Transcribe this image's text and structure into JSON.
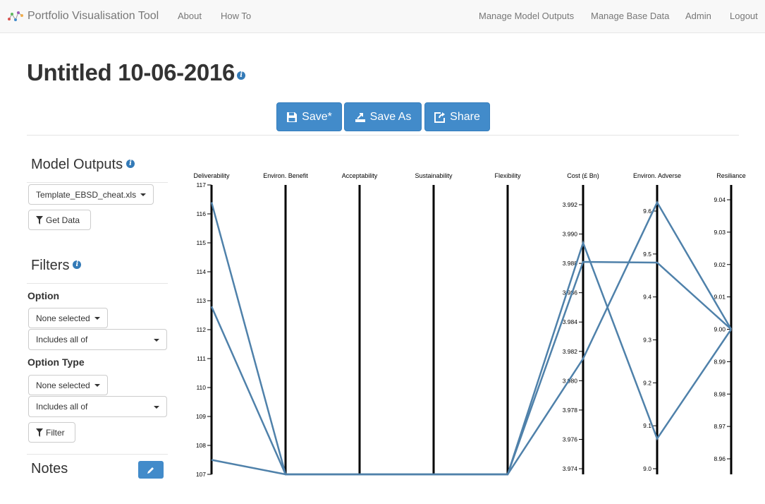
{
  "navbar": {
    "brand": "Portfolio Visualisation Tool",
    "links_left": [
      "About",
      "How To"
    ],
    "links_right": [
      "Manage Model Outputs",
      "Manage Base Data",
      "Admin",
      "Logout"
    ]
  },
  "page": {
    "title": "Untitled 10-06-2016"
  },
  "toolbar": {
    "save_label": "Save*",
    "save_as_label": "Save As",
    "share_label": "Share"
  },
  "sidebar": {
    "model_outputs_heading": "Model Outputs",
    "file_select": "Template_EBSD_cheat.xls",
    "get_data_label": "Get Data",
    "filters_heading": "Filters",
    "option_label": "Option",
    "option_selected": "None selected",
    "option_mode": "Includes all of",
    "option_type_label": "Option Type",
    "option_type_selected": "None selected",
    "option_type_mode": "Includes all of",
    "filter_label": "Filter",
    "notes_heading": "Notes"
  },
  "chart_data": {
    "type": "parallel-coordinates",
    "axes": [
      {
        "label": "Deliverability",
        "ticks": [
          "117",
          "116",
          "115",
          "114",
          "113",
          "112",
          "111",
          "110",
          "109",
          "108",
          "107"
        ]
      },
      {
        "label": "Environ. Benefit",
        "ticks": []
      },
      {
        "label": "Acceptability",
        "ticks": []
      },
      {
        "label": "Sustainability",
        "ticks": []
      },
      {
        "label": "Flexibility",
        "ticks": []
      },
      {
        "label": "Cost (£ Bn)",
        "ticks": [
          "3.992",
          "3.990",
          "3.988",
          "3.986",
          "3.984",
          "3.982",
          "3.980",
          "3.978",
          "3.976",
          "3.974"
        ]
      },
      {
        "label": "Environ. Adverse",
        "ticks": [
          "9.6",
          "9.5",
          "9.4",
          "9.3",
          "9.2",
          "9.1",
          "9.0"
        ]
      },
      {
        "label": "Resiliance",
        "ticks": [
          "9.04",
          "9.03",
          "9.02",
          "9.01",
          "9.00",
          "8.99",
          "8.98",
          "8.97",
          "8.96"
        ]
      }
    ],
    "series": [
      {
        "values": [
          116.4,
          0,
          0,
          0,
          0,
          3.9881,
          9.48,
          9.0
        ]
      },
      {
        "values": [
          112.8,
          0,
          0,
          0,
          0,
          3.9894,
          9.07,
          9.0
        ]
      },
      {
        "values": [
          107.5,
          0,
          0,
          0,
          0,
          3.9815,
          9.62,
          9.0
        ]
      }
    ],
    "line_color": "#4f81aa"
  }
}
